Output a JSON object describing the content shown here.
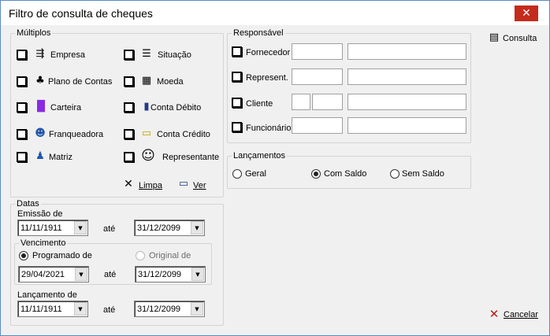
{
  "window": {
    "title": "Filtro de consulta de cheques",
    "close_glyph": "✕"
  },
  "multiplos": {
    "title": "Múltiplos",
    "left_items": [
      {
        "label": "Empresa",
        "icon": "network-icon"
      },
      {
        "label": "Plano de Contas",
        "icon": "hierarchy-icon"
      },
      {
        "label": "Carteira",
        "icon": "books-icon"
      },
      {
        "label": "Franqueadora",
        "icon": "users-icon"
      },
      {
        "label": "Matriz",
        "icon": "person-icon"
      }
    ],
    "right_items": [
      {
        "label": "Situação",
        "icon": "list-icon"
      },
      {
        "label": "Moeda",
        "icon": "calculator-icon"
      },
      {
        "label": "Conta Débito",
        "icon": "book-icon"
      },
      {
        "label": "Conta Crédito",
        "icon": "folders-icon"
      },
      {
        "label": "Representante",
        "icon": "globe-person-icon"
      }
    ],
    "limpa_label": "Limpa",
    "ver_label": "Ver"
  },
  "responsavel": {
    "title": "Responsável",
    "rows": [
      {
        "label": "Fornecedor"
      },
      {
        "label": "Represent."
      },
      {
        "label": "Cliente"
      },
      {
        "label": "Funcionário"
      }
    ]
  },
  "lancamentos": {
    "title": "Lançamentos",
    "options": [
      "Geral",
      "Com Saldo",
      "Sem Saldo"
    ],
    "selected": "Com Saldo"
  },
  "datas": {
    "title": "Datas",
    "emissao_label": "Emissão de",
    "emissao_from": "11/11/1911",
    "emissao_to": "31/12/2099",
    "ate": "até",
    "vencimento_title": "Vencimento",
    "programado_label": "Programado de",
    "original_label": "Original de",
    "venc_from": "29/04/2021",
    "venc_to": "31/12/2099",
    "lancamento_label": "Lançamento de",
    "lanc_from": "11/11/1911",
    "lanc_to": "31/12/2099"
  },
  "actions": {
    "consulta_label": "Consulta",
    "cancelar_label": "Cancelar"
  }
}
